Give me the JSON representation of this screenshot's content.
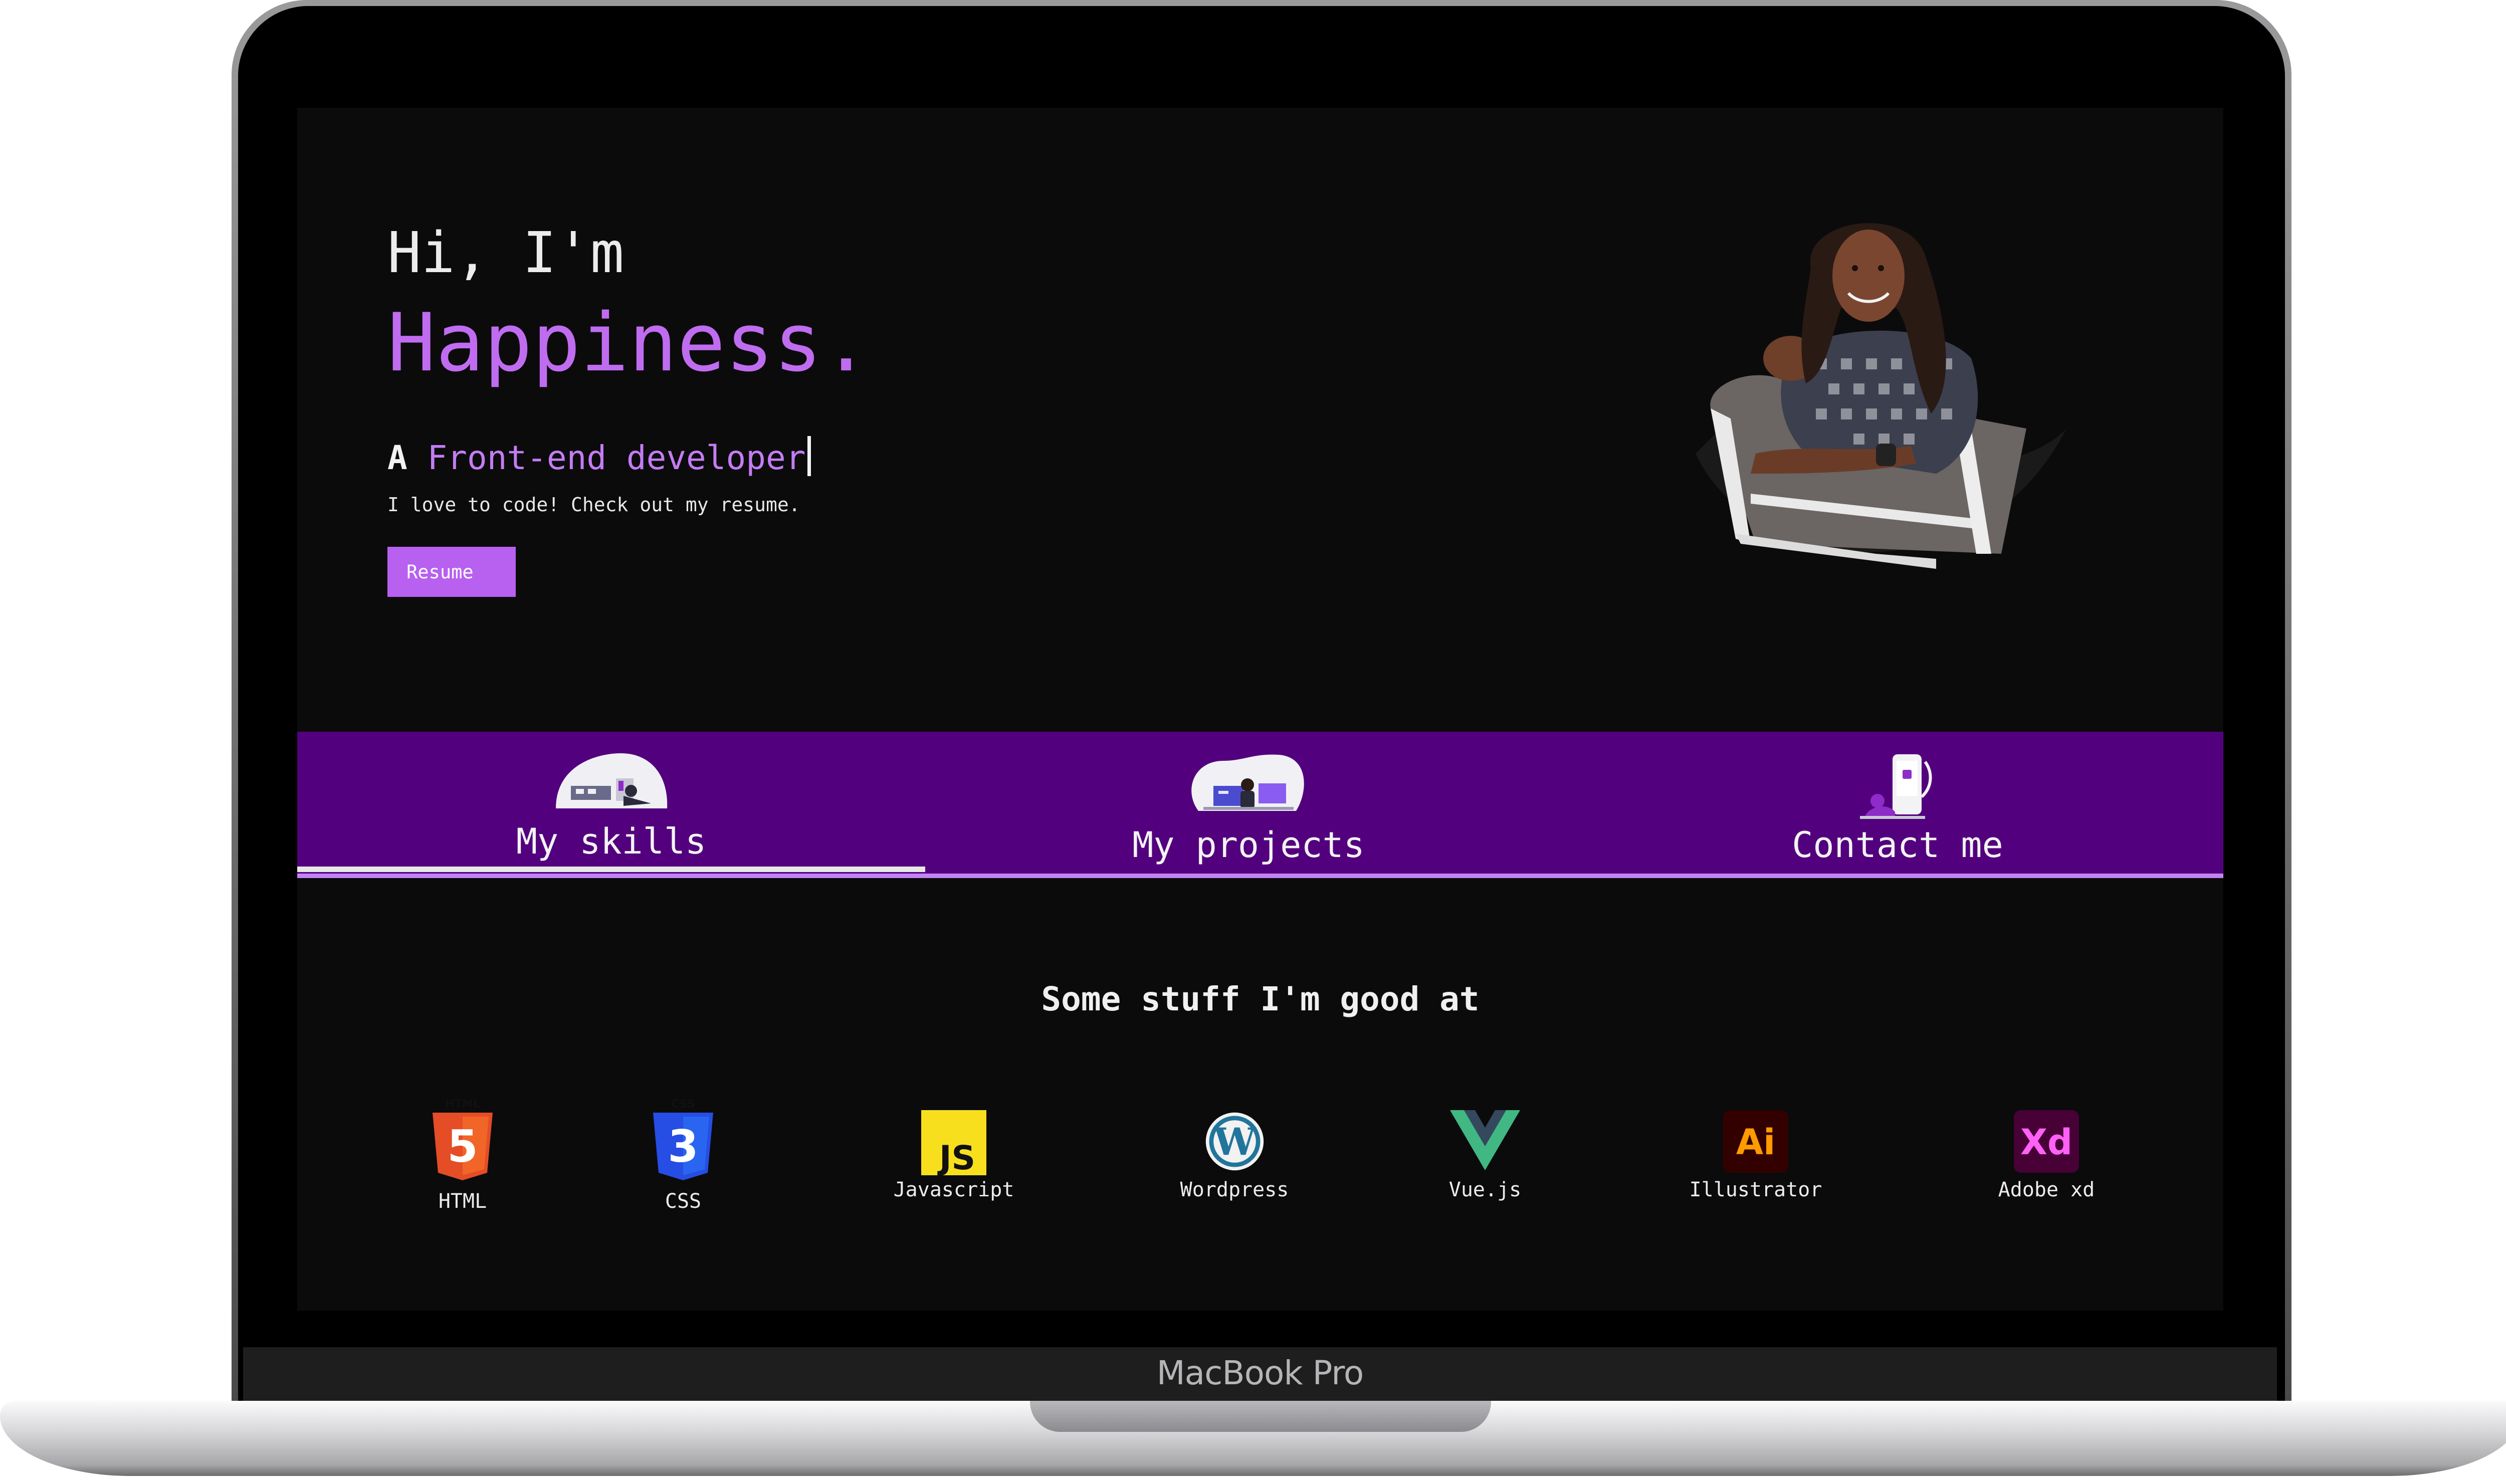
{
  "device": {
    "brand_label": "MacBook Pro"
  },
  "hero": {
    "greeting": "Hi, I'm",
    "name": "Happiness.",
    "role_prefix": "A",
    "role_title": "Front-end developer",
    "tagline": "I love to code! Check out my resume.",
    "resume_button": "Resume"
  },
  "nav": {
    "tabs": [
      {
        "label": "My skills",
        "active": true
      },
      {
        "label": "My projects",
        "active": false
      },
      {
        "label": "Contact me",
        "active": false
      }
    ]
  },
  "skills": {
    "heading": "Some stuff I'm good at",
    "items": [
      {
        "name": "HTML",
        "icon": "html5-icon",
        "badge": "HTML"
      },
      {
        "name": "CSS",
        "icon": "css3-icon",
        "badge": "CSS"
      },
      {
        "name": "Javascript",
        "icon": "javascript-icon",
        "badge": "JS"
      },
      {
        "name": "Wordpress",
        "icon": "wordpress-icon"
      },
      {
        "name": "Vue.js",
        "icon": "vuejs-icon"
      },
      {
        "name": "Illustrator",
        "icon": "illustrator-icon",
        "badge": "Ai"
      },
      {
        "name": "Adobe xd",
        "icon": "adobe-xd-icon",
        "badge": "Xd"
      }
    ]
  },
  "colors": {
    "accent": "#c06cf0",
    "nav_band": "#53007e",
    "screen_bg": "#0b0b0c",
    "button": "#b860ef"
  }
}
